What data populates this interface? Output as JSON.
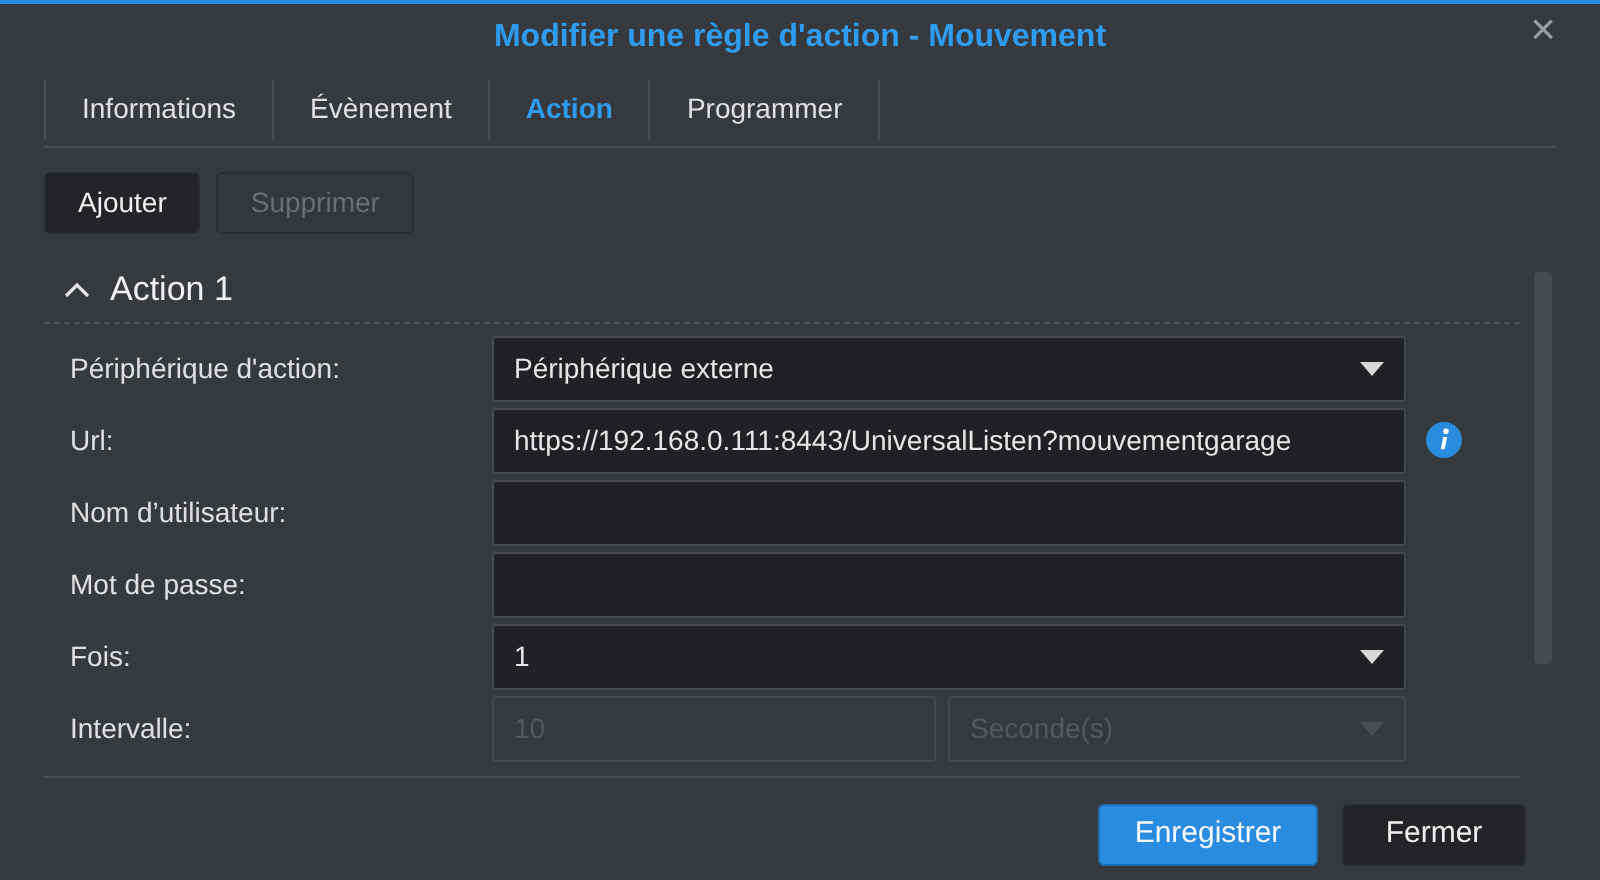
{
  "window": {
    "title": "Modifier une règle d'action - Mouvement",
    "close": "×"
  },
  "tabs": [
    {
      "label": "Informations",
      "selected": false
    },
    {
      "label": "Évènement",
      "selected": false
    },
    {
      "label": "Action",
      "selected": true
    },
    {
      "label": "Programmer",
      "selected": false
    }
  ],
  "toolbar": [
    {
      "label": "Ajouter",
      "disabled": false
    },
    {
      "label": "Supprimer",
      "disabled": true
    }
  ],
  "section": {
    "title": "Action 1",
    "expanded": true
  },
  "fields": [
    {
      "kind": "select",
      "label": "Périphérique d'action:",
      "value": "Périphérique externe",
      "disabled": false
    },
    {
      "kind": "text",
      "label": "Url:",
      "value": "https://192.168.0.111:8443/UniversalListen?mouvementgarage",
      "info": true,
      "disabled": false
    },
    {
      "kind": "text",
      "label": "Nom d’utilisateur:",
      "info": false,
      "disabled": false
    },
    {
      "kind": "text",
      "label": "Mot de passe:",
      "info": false,
      "disabled": false
    },
    {
      "kind": "select",
      "label": "Fois:",
      "value": "1",
      "disabled": false
    },
    {
      "kind": "interval",
      "label": "Intervalle:",
      "value": "10",
      "unit": "Seconde(s)",
      "disabled": true
    }
  ],
  "footer": [
    {
      "label": "Enregistrer",
      "primary": true
    },
    {
      "label": "Fermer",
      "primary": false
    }
  ]
}
